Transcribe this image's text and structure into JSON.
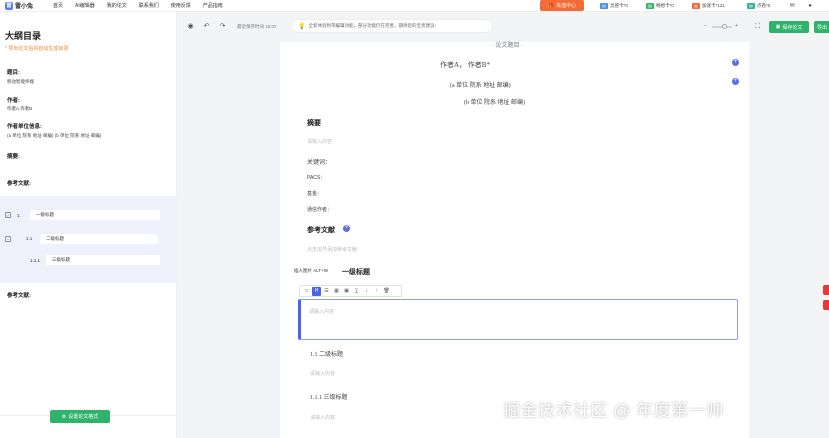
{
  "nav": {
    "logo_mark": "雷",
    "logo_text": "雷小兔",
    "items": [
      "首页",
      "AI编辑器",
      "我的论文",
      "联系我们",
      "使用反馈",
      "产品指南"
    ],
    "recharge": "充值中心",
    "recharge_icon": "gift-icon",
    "cards": [
      {
        "label": "灵感卡*0",
        "color": "#4a8ff7"
      },
      {
        "label": "畅想卡*0",
        "color": "#34b86c"
      },
      {
        "label": "加速卡*121",
        "color": "#f0673a"
      },
      {
        "label": "点卷*0",
        "color": "#2cb5a0"
      }
    ]
  },
  "sidebar": {
    "title": "大纲目录",
    "note": "* 导出论文后将自动生成目录",
    "topic_label": "题目:",
    "topic_value": "移动智能终端",
    "author_label": "作者:",
    "author_value": "作者A,作者B",
    "unit_label": "作者单位信息:",
    "unit_value": "(a 单位 院系 地址 邮编) (b 单位 院系 地址 邮编)",
    "abstract_label": "摘要:",
    "refs_label": "参考文献:",
    "outline": [
      {
        "num": "1.",
        "text": "一级标题"
      },
      {
        "num": "1.1",
        "text": "二级标题"
      },
      {
        "num": "1.1.1",
        "text": "三级标题"
      }
    ],
    "refs_label_2": "参考文献:",
    "set_format": "设置论文格式"
  },
  "toolbar": {
    "autosave": "最近保存时间 15:07",
    "notice": "全新体验附带编辑功能，部分功能仍在完善，期待您的宝贵建议!",
    "zoom_minus": "−",
    "zoom_plus": "+",
    "zoom_level": 0.5,
    "save": "保存论文",
    "save2": "导出"
  },
  "paper": {
    "title_fragment": "· 论文题目 ·",
    "authors": "作者A，      作者B*",
    "unit_a": "(a 单位  院系  地址  邮编)",
    "unit_b": "(b 单位  院系  地址  邮编)",
    "abstract_heading": "摘要",
    "abstract_ph": "请输入内容",
    "keywords": "关键词：",
    "pacs": "PACS：",
    "fund": "基金：",
    "corresponding": "通信作者：",
    "refs_heading": "参考文献",
    "refs_ph": "点击加号添加参考文献",
    "insert_hint": "插入图片 ALT+W",
    "h1": "一级标题",
    "edit_ph": "请输入内容",
    "h2": "1.1  二级标题",
    "h2_ph": "请输入内容",
    "h3": "1.1.1  三级标题",
    "h3_ph": "请输入内容"
  },
  "watermark": "掘金技术社区 @ 年度第一帅"
}
